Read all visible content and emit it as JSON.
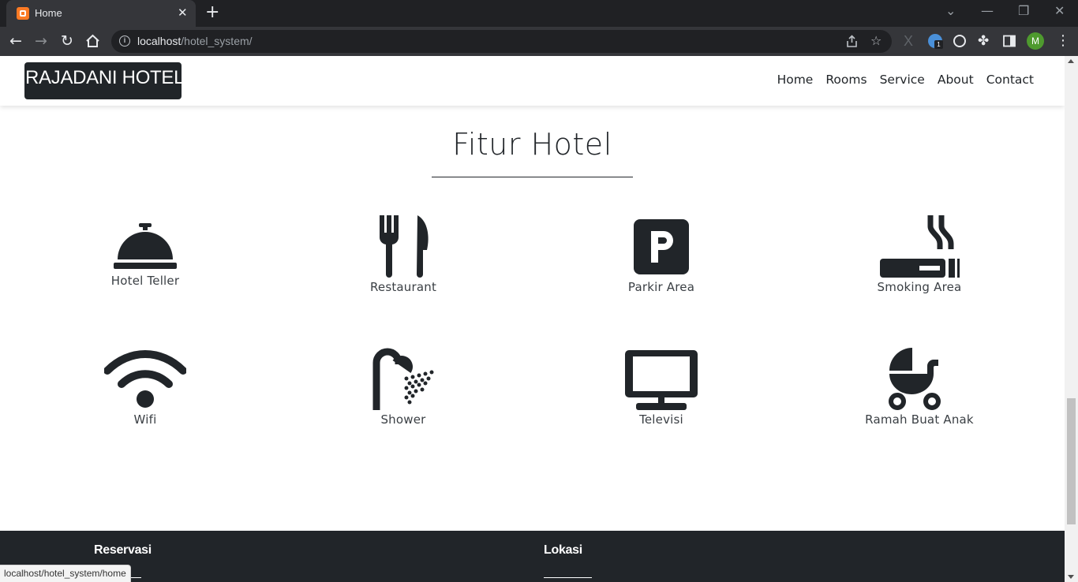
{
  "browser": {
    "tab_title": "Home",
    "url_host": "localhost",
    "url_path": "/hotel_system/",
    "profile_initial": "M",
    "extension_badge": "1",
    "status_url": "localhost/hotel_system/home"
  },
  "header": {
    "brand": "RAJADANI HOTEL",
    "nav": [
      "Home",
      "Rooms",
      "Service",
      "About",
      "Contact"
    ]
  },
  "features": {
    "title": "Fitur Hotel",
    "items": [
      {
        "label": "Hotel Teller",
        "icon": "concierge-bell-icon"
      },
      {
        "label": "Restaurant",
        "icon": "utensils-icon"
      },
      {
        "label": "Parkir Area",
        "icon": "parking-icon"
      },
      {
        "label": "Smoking Area",
        "icon": "smoking-icon"
      },
      {
        "label": "Wifi",
        "icon": "wifi-icon"
      },
      {
        "label": "Shower",
        "icon": "shower-icon"
      },
      {
        "label": "Televisi",
        "icon": "tv-icon"
      },
      {
        "label": "Ramah Buat Anak",
        "icon": "baby-carriage-icon"
      }
    ]
  },
  "footer": {
    "col1_heading": "Reservasi",
    "col2_heading": "Lokasi"
  },
  "colors": {
    "dark": "#212529",
    "chrome_bg": "#202124",
    "chrome_toolbar": "#35363a"
  }
}
